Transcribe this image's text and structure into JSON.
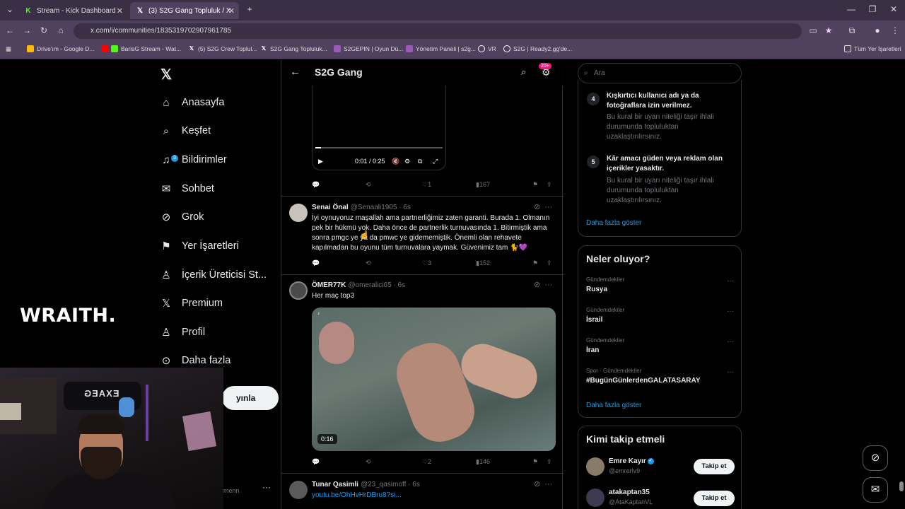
{
  "browser": {
    "tabs": [
      {
        "label": "Stream - Kick Dashboard",
        "icon": "K",
        "icon_color": "#53fc18"
      },
      {
        "label": "(3) S2G Gang Topluluk / X",
        "icon": "X",
        "icon_color": "#ffffff"
      }
    ],
    "url": "x.com/i/communities/1835319702907961785",
    "bookmarks": [
      {
        "label": "Drive'ım - Google D...",
        "icon_color": "#fbbc04"
      },
      {
        "label": "BarisG Stream - Wat...",
        "icon_color": "#53fc18"
      },
      {
        "label": "(5) S2G Crew Toplul...",
        "icon_color": "#ffffff"
      },
      {
        "label": "S2G Gang Topluluk...",
        "icon_color": "#ffffff"
      },
      {
        "label": "S2GEPIN | Oyun Dü...",
        "icon_color": "#9b59b6"
      },
      {
        "label": "Yönetim Paneli | s2g...",
        "icon_color": "#9b59b6"
      },
      {
        "label": "VR",
        "icon_color": "#ffffff"
      },
      {
        "label": "S2G | Ready2.gg'de...",
        "icon_color": "#ffffff"
      }
    ],
    "all_bookmarks": "Tüm Yer İşaretleri"
  },
  "nav": {
    "items": [
      "Anasayfa",
      "Keşfet",
      "Bildirimler",
      "Sohbet",
      "Grok",
      "Yer İşaretleri",
      "İçerik Üreticisi St...",
      "Premium",
      "Profil",
      "Daha fazla"
    ],
    "notif_badge": "3",
    "post_label": "yınla"
  },
  "main": {
    "title": "S2G Gang",
    "badge": "20+",
    "video1": {
      "time": "0:01 / 0:25",
      "likes": "1",
      "views": "167"
    },
    "tweets": [
      {
        "name": "Senai Önal",
        "handle": "@Senaali1905 · 6s",
        "text": "İyi oynuyoruz maşallah ama partnerliğimiz zaten garanti. Burada 1. Olmanın pek bir hükmü yok. Daha önce de partnerlik turnuvasında 1. Bitirmiştik ama sonra pmgc ye ya da pmwc ye gidememiştik. Önemli olan rehavete kapılmadan bu oyunu tüm turnuvalara yaymak. Güvenimiz tam 🐈💜",
        "likes": "3",
        "views": "152"
      },
      {
        "name": "ÖMER77K",
        "handle": "@omeralici65 · 6s",
        "text": "Her maç top3",
        "duration": "0:16",
        "likes": "2",
        "views": "146"
      },
      {
        "name": "Tunar Qasimli",
        "handle": "@23_qasimoff · 6s",
        "text": "youtu.be/OhHvHrDBru8?si..."
      }
    ]
  },
  "right": {
    "search_placeholder": "Ara",
    "rules": [
      {
        "num": "4",
        "title": "Kışkırtıcı kullanıcı adı ya da fotoğraflara izin verilmez.",
        "desc": "Bu kural bir uyarı niteliği taşır ihlali durumunda topluluktan uzaklaştırılırsınız."
      },
      {
        "num": "5",
        "title": "Kâr amacı güden veya reklam olan içerikler yasaktır.",
        "desc": "Bu kural bir uyarı niteliği taşır ihlali durumunda topluluktan uzaklaştırılırsınız."
      }
    ],
    "show_more": "Daha fazla göster",
    "trends_title": "Neler oluyor?",
    "trends": [
      {
        "cat": "Gündemdekiler",
        "name": "Rusya"
      },
      {
        "cat": "Gündemdekiler",
        "name": "İsrail"
      },
      {
        "cat": "Gündemdekiler",
        "name": "İran"
      },
      {
        "cat": "Spor · Gündemdekiler",
        "name": "#BugünGünlerdenGALATASARAY"
      }
    ],
    "who_to_follow": "Kimi takip etmeli",
    "follow": [
      {
        "name": "Emre Kayır",
        "handle": "@emrerlv9",
        "button": "Takip et"
      },
      {
        "name": "atakaptan35",
        "handle": "@AtaKaptanVL",
        "button": "Takip et"
      }
    ]
  },
  "overlay": {
    "brand": "WRAITH.",
    "chair_text": "EXAEG",
    "bottom_user": "menn"
  }
}
